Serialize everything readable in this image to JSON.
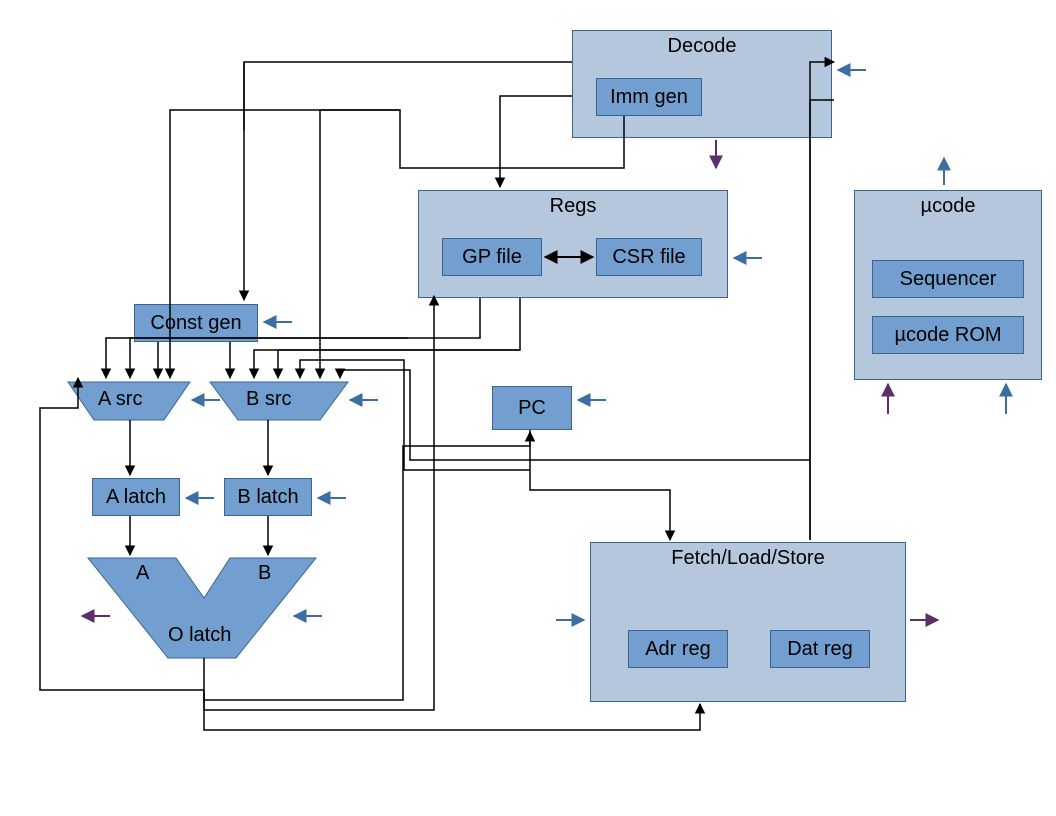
{
  "blocks": {
    "decode_title": "Decode",
    "imm_gen": "Imm gen",
    "regs_title": "Regs",
    "gp_file": "GP file",
    "csr_file": "CSR file",
    "const_gen": "Const gen",
    "a_src": "A src",
    "b_src": "B src",
    "a_latch": "A latch",
    "b_latch": "B latch",
    "pc": "PC",
    "ucode_title": "µcode",
    "sequencer": "Sequencer",
    "ucode_rom": "µcode ROM",
    "fetch_title": "Fetch/Load/Store",
    "adr_reg": "Adr reg",
    "dat_reg": "Dat reg",
    "alu_a": "A",
    "alu_b": "B",
    "o_latch": "O latch"
  }
}
